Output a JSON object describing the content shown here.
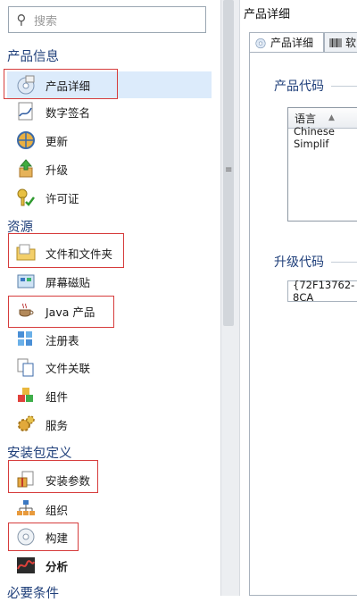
{
  "search": {
    "placeholder": "搜索"
  },
  "sidebar": {
    "groups": [
      {
        "title": "产品信息",
        "items": [
          {
            "label": "产品详细",
            "icon": "product-details-icon"
          },
          {
            "label": "数字签名",
            "icon": "digital-signature-icon"
          },
          {
            "label": "更新",
            "icon": "update-globe-icon"
          },
          {
            "label": "升级",
            "icon": "upgrade-box-icon"
          },
          {
            "label": "许可证",
            "icon": "license-key-icon"
          }
        ]
      },
      {
        "title": "资源",
        "items": [
          {
            "label": "文件和文件夹",
            "icon": "folder-icon"
          },
          {
            "label": "屏幕磁贴",
            "icon": "screen-tiles-icon"
          },
          {
            "label": "Java 产品",
            "icon": "java-cup-icon"
          },
          {
            "label": "注册表",
            "icon": "registry-icon"
          },
          {
            "label": "文件关联",
            "icon": "file-association-icon"
          },
          {
            "label": "组件",
            "icon": "components-icon"
          },
          {
            "label": "服务",
            "icon": "services-gear-icon"
          }
        ]
      },
      {
        "title": "安装包定义",
        "items": [
          {
            "label": "安装参数",
            "icon": "install-parameters-icon"
          },
          {
            "label": "组织",
            "icon": "organization-icon"
          },
          {
            "label": "构建",
            "icon": "build-disc-icon"
          },
          {
            "label": "分析",
            "icon": "analysis-icon"
          }
        ]
      },
      {
        "title": "必要条件",
        "items": []
      }
    ]
  },
  "right": {
    "title": "产品详细",
    "tabs": [
      {
        "label": "产品详细",
        "icon": "product-details-icon"
      },
      {
        "label": "软",
        "icon": "barcode-icon"
      }
    ],
    "product_code_title": "产品代码",
    "table": {
      "header": "语言",
      "rows": [
        "Chinese Simplif"
      ]
    },
    "upgrade_code_title": "升级代码",
    "upgrade_code_value": "{72F13762-8CA"
  },
  "colors": {
    "highlight": "#d63c3c",
    "selected": "#dcebfb",
    "section_title": "#1f3f7a"
  }
}
